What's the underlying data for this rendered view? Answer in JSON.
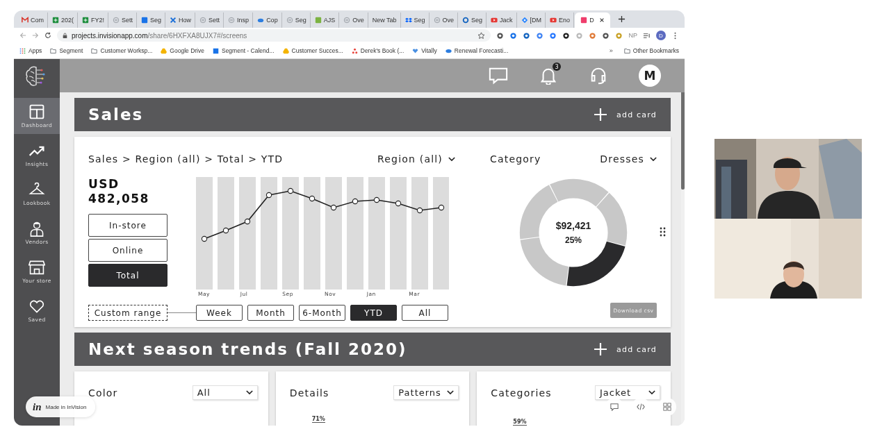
{
  "browser": {
    "tabs": [
      {
        "label": "Com",
        "kind": "mail",
        "selected": false
      },
      {
        "label": "202(",
        "kind": "sheet",
        "selected": false
      },
      {
        "label": "FY2!",
        "kind": "sheet",
        "selected": false
      },
      {
        "label": "Sett",
        "kind": "ring",
        "selected": false
      },
      {
        "label": "Seg",
        "kind": "calendar",
        "selected": false
      },
      {
        "label": "How",
        "kind": "cross",
        "selected": false
      },
      {
        "label": "Sett",
        "kind": "ring",
        "selected": false
      },
      {
        "label": "Insp",
        "kind": "ring",
        "selected": false
      },
      {
        "label": "Cop",
        "kind": "cloud",
        "selected": false
      },
      {
        "label": "Seg",
        "kind": "ring",
        "selected": false
      },
      {
        "label": "AJS",
        "kind": "bar",
        "selected": false
      },
      {
        "label": "Ove",
        "kind": "ring",
        "selected": false
      },
      {
        "label": "New Tab",
        "kind": "none",
        "selected": false
      },
      {
        "label": "Seg",
        "kind": "box",
        "selected": false
      },
      {
        "label": "Ove",
        "kind": "ring",
        "selected": false
      },
      {
        "label": "Seg",
        "kind": "circle",
        "selected": false
      },
      {
        "label": "Jack",
        "kind": "video",
        "selected": false
      },
      {
        "label": "[DM",
        "kind": "jira",
        "selected": false
      },
      {
        "label": "Eno",
        "kind": "video",
        "selected": false
      },
      {
        "label": "D",
        "kind": "square",
        "selected": true
      }
    ],
    "url": "**projects.invisionapp.com**/share/6HXFXA8UJX7#/screens",
    "extension_label": "NP",
    "profile_initial": "D",
    "bookmarks": [
      {
        "label": "Apps",
        "kind": "apps"
      },
      {
        "label": "Segment",
        "kind": "folder"
      },
      {
        "label": "Customer Worksp...",
        "kind": "folder"
      },
      {
        "label": "Google Drive",
        "kind": "drive"
      },
      {
        "label": "Segment - Calend...",
        "kind": "calendar"
      },
      {
        "label": "Customer Succes...",
        "kind": "drive"
      },
      {
        "label": "Derek's Book (...",
        "kind": "dots"
      },
      {
        "label": "Vitally",
        "kind": "heart"
      },
      {
        "label": "Renewal Forecasti...",
        "kind": "cloud"
      }
    ],
    "bookmarks_overflow": "»",
    "other_bookmarks": "Other Bookmarks"
  },
  "app": {
    "sidebar": {
      "items": [
        {
          "label": "Dashboard",
          "kind": "dashboard",
          "selected": true
        },
        {
          "label": "Insights",
          "kind": "trend",
          "selected": false
        },
        {
          "label": "Lookbook",
          "kind": "hanger",
          "selected": false
        },
        {
          "label": "Vendors",
          "kind": "person",
          "selected": false
        },
        {
          "label": "Your store",
          "kind": "store",
          "selected": false
        },
        {
          "label": "Saved",
          "kind": "heart",
          "selected": false
        }
      ]
    },
    "top_bar": {
      "notification_count": "3",
      "avatar_initial": "M"
    },
    "sales": {
      "title": "Sales",
      "add_label": "add card",
      "breadcrumb": "Sales > Region (all) > Total > YTD",
      "region_filter": "Region (all)",
      "currency": "USD",
      "total": "482,058",
      "channels": [
        {
          "label": "In-store",
          "selected": false
        },
        {
          "label": "Online",
          "selected": false
        },
        {
          "label": "Total",
          "selected": true
        }
      ],
      "month_labels": [
        "May",
        "Jul",
        "Sep",
        "Nov",
        "Jan",
        "Mar"
      ],
      "custom_range": "Custom range",
      "ranges": [
        {
          "label": "Week",
          "selected": false
        },
        {
          "label": "Month",
          "selected": false
        },
        {
          "label": "6-Month",
          "selected": false
        },
        {
          "label": "YTD",
          "selected": true
        },
        {
          "label": "All",
          "selected": false
        }
      ],
      "category_label": "Category",
      "category_filter": "Dresses",
      "donut_value": "$92,421",
      "donut_share": "25%",
      "download": {
        "label": "Download csv",
        "disabled": true
      }
    },
    "trends": {
      "title": "Next season trends (Fall 2020)",
      "add_label": "add card",
      "cards": [
        {
          "label": "Color",
          "filter": "All"
        },
        {
          "label": "Details",
          "filter": "Patterns",
          "peek_value": "71%"
        },
        {
          "label": "Categories",
          "filter": "Jacket",
          "peek_value": "59%"
        }
      ]
    },
    "invision_logo": "in",
    "invision_badge": "Made in InVision"
  }
}
